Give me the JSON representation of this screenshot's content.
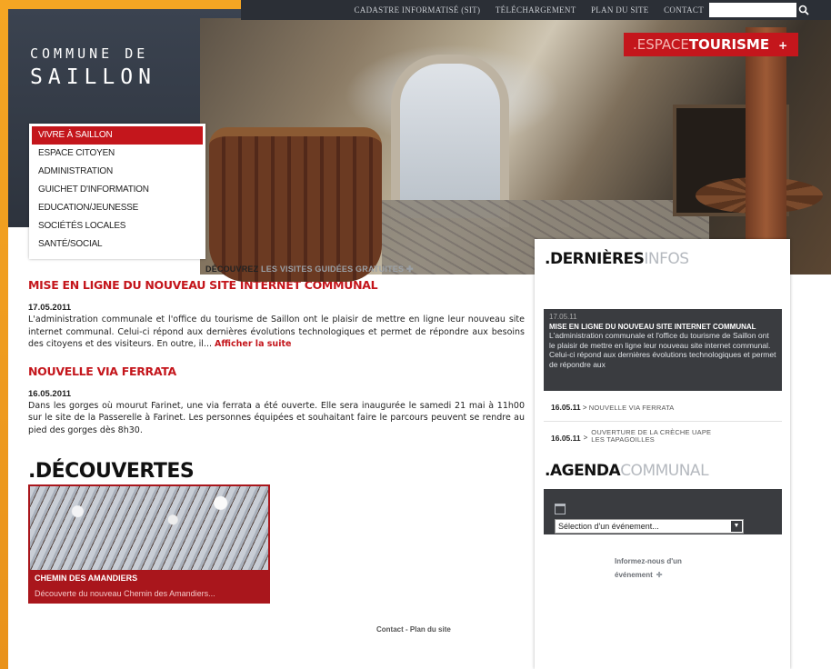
{
  "topbar": {
    "links": [
      "CADASTRE INFORMATISÉ (SIT)",
      "TÉLÉCHARGEMENT",
      "PLAN DU SITE",
      "CONTACT"
    ],
    "search_placeholder": ""
  },
  "logo": {
    "line1": "COMMUNE DE",
    "line2": "SAILLON"
  },
  "tourisme": {
    "prefix": ".ESPACE",
    "main": "TOURISME",
    "arrow": "+"
  },
  "nav": {
    "items": [
      "VIVRE À SAILLON",
      "ESPACE CITOYEN",
      "ADMINISTRATION",
      "GUICHET D'INFORMATION",
      "EDUCATION/JEUNESSE",
      "SOCIÉTÉS LOCALES",
      "SANTÉ/SOCIAL"
    ],
    "active_index": 0
  },
  "hero_link": {
    "bold": "DÉCOUVREZ",
    "rest": "LES VISITES GUIDÉES GRATUITES",
    "arrow": "✚"
  },
  "news": [
    {
      "title": "MISE EN LIGNE DU NOUVEAU SITE INTERNET COMMUNAL",
      "date": "17.05.2011",
      "body": "L'administration communale et l'office du tourisme de Saillon ont le plaisir de mettre en ligne leur nouveau site internet communal. Celui-ci répond aux dernières évolutions technologiques et permet de répondre aux besoins des citoyens et des visiteurs. En outre, il...",
      "more": "Afficher la suite"
    },
    {
      "title": "NOUVELLE VIA FERRATA",
      "date": "16.05.2011",
      "body": "Dans les gorges où mourut Farinet, une via ferrata a été ouverte. Elle sera inaugurée le samedi 21 mai à 11h00 sur le site de la Passerelle à Farinet. Les personnes équipées et souhaitant faire le parcours peuvent se rendre au pied des gorges dès 8h30."
    }
  ],
  "decouvertes": {
    "title": ".DÉCOUVERTES",
    "card_title": "CHEMIN DES AMANDIERS",
    "card_desc": "Découverte du nouveau Chemin des Amandiers..."
  },
  "footer": {
    "contact": "Contact",
    "sep": "-",
    "plan": "Plan du site"
  },
  "sidebar": {
    "infos_title_bold": ".DERNIÈRES",
    "infos_title_light": "INFOS",
    "featured": {
      "date": "17.05.11",
      "title": "MISE EN LIGNE DU NOUVEAU SITE INTERNET COMMUNAL",
      "body": "L'administration communale et l'office du tourisme de Saillon ont le plaisir de mettre en ligne leur nouveau site internet communal. Celui-ci répond aux dernières évolutions technologiques et permet de répondre aux"
    },
    "items": [
      {
        "date": "16.05.11",
        "sep": ">",
        "title": "NOUVELLE VIA FERRATA"
      },
      {
        "date": "16.05.11",
        "sep": ">",
        "title": "OUVERTURE DE LA CRÈCHE UAPE LES TAPAGOILLES"
      }
    ],
    "agenda_title_bold": ".AGENDA",
    "agenda_title_light": "COMMUNAL",
    "event_select": "Sélection d'un événement...",
    "inform": "Informez-nous d'un événement",
    "inform_arrow": "✚"
  }
}
